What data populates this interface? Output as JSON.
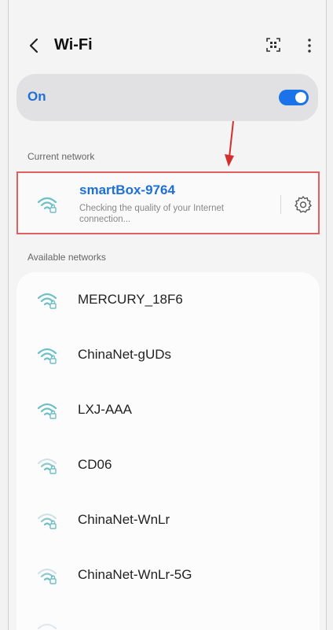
{
  "header": {
    "title": "Wi-Fi"
  },
  "toggle": {
    "label": "On",
    "enabled": true,
    "accent": "#1a73e8"
  },
  "current": {
    "section_label": "Current network",
    "name": "smartBox-9764",
    "status": "Checking the quality of your Internet connection..."
  },
  "available": {
    "section_label": "Available networks",
    "networks": [
      {
        "name": "MERCURY_18F6"
      },
      {
        "name": "ChinaNet-gUDs"
      },
      {
        "name": "LXJ-AAA"
      },
      {
        "name": "CD06"
      },
      {
        "name": "ChinaNet-WnLr"
      },
      {
        "name": "ChinaNet-WnLr-5G"
      }
    ]
  }
}
